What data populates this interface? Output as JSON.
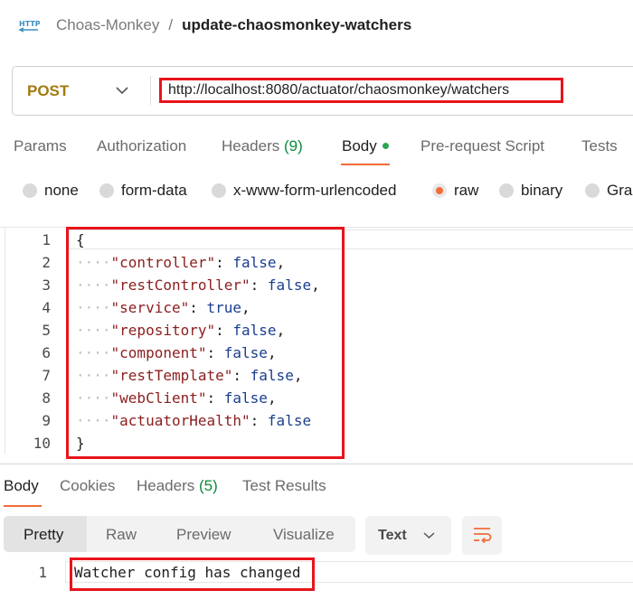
{
  "breadcrumb": {
    "icon": "http-request-icon",
    "collection": "Choas-Monkey",
    "separator": "/",
    "request": "update-chaosmonkey-watchers"
  },
  "request": {
    "method": "POST",
    "url": "http://localhost:8080/actuator/chaosmonkey/watchers",
    "tabs": [
      {
        "label": "Params"
      },
      {
        "label": "Authorization"
      },
      {
        "label": "Headers",
        "count": "(9)"
      },
      {
        "label": "Body",
        "active": true
      },
      {
        "label": "Pre-request Script"
      },
      {
        "label": "Tests"
      }
    ],
    "body_types": [
      "none",
      "form-data",
      "x-www-form-urlencoded",
      "raw",
      "binary",
      "Gra"
    ],
    "selected_body_type": "raw"
  },
  "editor": {
    "lines": [
      {
        "n": "1",
        "open": "{"
      },
      {
        "n": "2",
        "key": "\"controller\"",
        "value": "false",
        "comma": ","
      },
      {
        "n": "3",
        "key": "\"restController\"",
        "value": "false",
        "comma": ","
      },
      {
        "n": "4",
        "key": "\"service\"",
        "value": "true",
        "comma": ","
      },
      {
        "n": "5",
        "key": "\"repository\"",
        "value": "false",
        "comma": ","
      },
      {
        "n": "6",
        "key": "\"component\"",
        "value": "false",
        "comma": ","
      },
      {
        "n": "7",
        "key": "\"restTemplate\"",
        "value": "false",
        "comma": ","
      },
      {
        "n": "8",
        "key": "\"webClient\"",
        "value": "false",
        "comma": ","
      },
      {
        "n": "9",
        "key": "\"actuatorHealth\"",
        "value": "false",
        "comma": ""
      },
      {
        "n": "10",
        "close": "}"
      }
    ]
  },
  "response": {
    "tabs": [
      {
        "label": "Body",
        "active": true
      },
      {
        "label": "Cookies"
      },
      {
        "label": "Headers",
        "count": "(5)"
      },
      {
        "label": "Test Results"
      }
    ],
    "views": [
      "Pretty",
      "Raw",
      "Preview",
      "Visualize"
    ],
    "active_view": "Pretty",
    "format": "Text",
    "line_number": "1",
    "body_text": "Watcher config has changed"
  },
  "colors": {
    "highlight_red": "#e8141b",
    "accent_orange": "#f26b3a",
    "method_post": "#a27b0d",
    "count_green": "#0c8a3c"
  }
}
